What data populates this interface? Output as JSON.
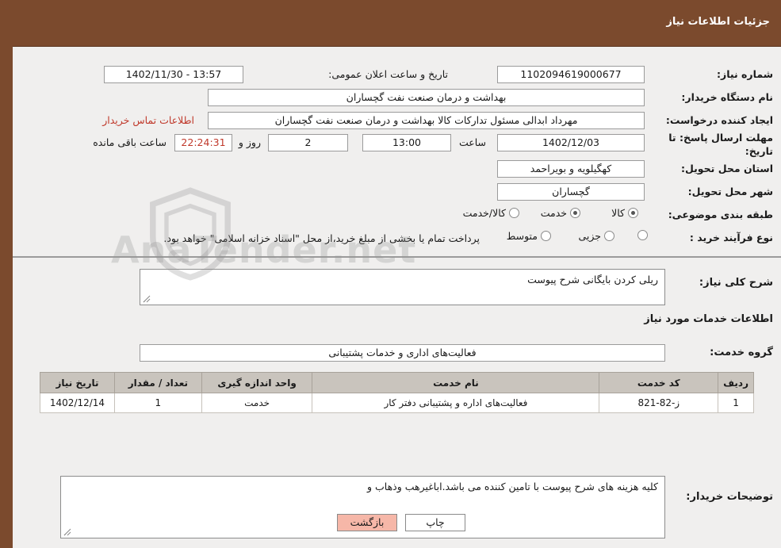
{
  "header": {
    "title": "جزئیات اطلاعات نیاز"
  },
  "form": {
    "need_number_label": "شماره نیاز:",
    "need_number_value": "1102094619000677",
    "announce_datetime_label": "تاریخ و ساعت اعلان عمومی:",
    "announce_datetime_value": "13:57 - 1402/11/30",
    "buyer_org_label": "نام دستگاه خریدار:",
    "buyer_org_value": "بهداشت و درمان صنعت نفت گچساران",
    "requester_label": "ایجاد کننده درخواست:",
    "requester_value": "مهرداد ابدالی مسئول تدارکات کالا  بهداشت و درمان صنعت نفت گچساران",
    "buyer_contact_link": "اطلاعات تماس خریدار",
    "deadline_label": "مهلت ارسال پاسخ: تا تاریخ:",
    "deadline_date": "1402/12/03",
    "deadline_hour_label": "ساعت",
    "deadline_hour": "13:00",
    "days_left": "2",
    "days_label": "روز و",
    "time_left": "22:24:31",
    "time_left_suffix": "ساعت باقی مانده",
    "province_label": "استان محل تحویل:",
    "province_value": "کهگیلویه و بویراحمد",
    "city_label": "شهر محل تحویل:",
    "city_value": "گچساران",
    "category_label": "طبقه بندی موضوعی:",
    "category_options": [
      "کالا",
      "خدمت",
      "کالا/خدمت"
    ],
    "category_selected": "خدمت",
    "purchase_type_label": "نوع فرآیند خرید :",
    "purchase_options": [
      "جزیی",
      "متوسط"
    ],
    "purchase_selected": "",
    "purchase_note": "پرداخت تمام یا بخشی از مبلغ خرید،از محل \"اسناد خزانه اسلامی\" خواهد بود."
  },
  "body": {
    "general_desc_label": "شرح کلی نیاز:",
    "general_desc_value": "ریلی کردن بایگانی شرح پیوست",
    "services_info_title": "اطلاعات خدمات مورد نیاز",
    "service_group_label": "گروه خدمت:",
    "service_group_value": "فعالیت‌های اداری و خدمات پشتیبانی",
    "table": {
      "headers": [
        "ردیف",
        "کد خدمت",
        "نام خدمت",
        "واحد اندازه گیری",
        "تعداد / مقدار",
        "تاریخ نیاز"
      ],
      "rows": [
        [
          "1",
          "ز-82-821",
          "فعالیت‌های اداره و پشتیبانی دفتر کار",
          "خدمت",
          "1",
          "1402/12/14"
        ]
      ]
    },
    "buyer_notes_label": "توضیحات خریدار:",
    "buyer_notes_value": "کلیه هزینه های شرح پیوست با تامین کننده می باشد.اباغیرهب وذهاب و"
  },
  "footer": {
    "print_label": "چاپ",
    "back_label": "بازگشت"
  },
  "watermark": {
    "text": "AnaTender.net"
  }
}
